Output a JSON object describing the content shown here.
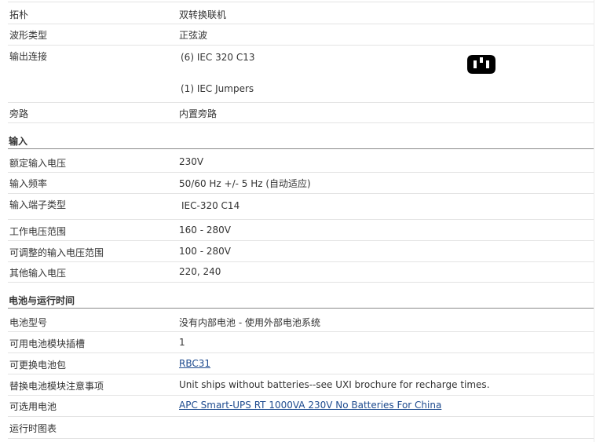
{
  "output_rows": [
    {
      "label": "拓朴",
      "value": "双转换联机"
    },
    {
      "label": "波形类型",
      "value": "正弦波"
    },
    {
      "label": "输出连接",
      "value": "(6) IEC 320 C13",
      "value2": "(1) IEC Jumpers"
    },
    {
      "label": "旁路",
      "value": "内置旁路"
    }
  ],
  "input_section": {
    "heading": "输入",
    "rows": [
      {
        "label": "额定输入电压",
        "value": "230V"
      },
      {
        "label": "输入频率",
        "value": "50/60 Hz +/- 5 Hz (自动适应)"
      },
      {
        "label": "输入端子类型",
        "value": "IEC-320 C14"
      },
      {
        "label": "工作电压范围",
        "value": "160 - 280V"
      },
      {
        "label": "可调整的输入电压范围",
        "value": "100 - 280V"
      },
      {
        "label": "其他输入电压",
        "value": "220, 240"
      }
    ]
  },
  "battery_section": {
    "heading": "电池与运行时间",
    "rows": [
      {
        "label": "电池型号",
        "value": "没有内部电池 - 使用外部电池系统"
      },
      {
        "label": "可用电池模块插槽",
        "value": "1"
      },
      {
        "label": "可更换电池包",
        "value": "RBC31"
      },
      {
        "label": "替换电池模块注意事项",
        "value": "Unit ships without batteries--see UXI brochure for recharge times."
      },
      {
        "label": "可选用电池",
        "value": "APC Smart-UPS RT 1000VA 230V No Batteries For China"
      },
      {
        "label": "运行时图表",
        "value": ""
      }
    ]
  },
  "icons": {
    "output_connection": "iec-c13-plug-icon"
  },
  "colors": {
    "link": "#1e4b8f",
    "section_rule": "#8a8a8a",
    "row_rule": "#e3e3e3"
  }
}
